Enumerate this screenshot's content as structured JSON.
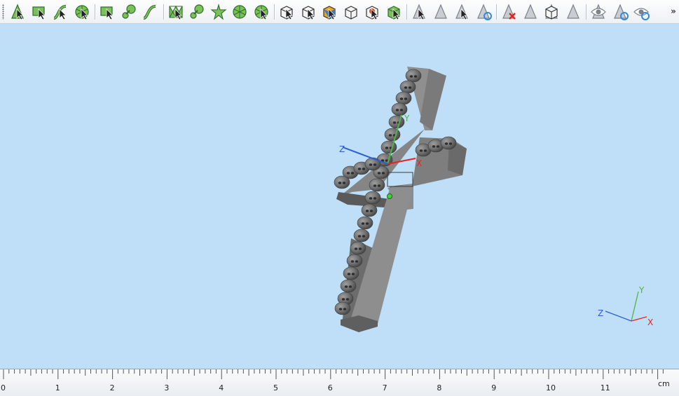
{
  "toolbar": {
    "groups": [
      [
        "select-face-icon",
        "select-surface-icon",
        "select-curve-surface-icon",
        "select-circle-face-icon"
      ],
      [
        "rectangle-select-icon",
        "blob-select-icon",
        "curve-select-icon"
      ],
      [
        "mesh-select-icon",
        "split-icon",
        "star-select-icon",
        "radial-select-icon",
        "radial-cut-icon"
      ],
      [
        "cube-select-icon",
        "cube-face-icon",
        "cube-orange-icon",
        "cube-wire-icon",
        "cube-red-icon",
        "cube-green-icon"
      ],
      [
        "triangle-icon",
        "triangle-edit-icon",
        "triangle-cursor-icon",
        "triangle-refresh-icon"
      ],
      [
        "triangle-delete-icon",
        "triangle-gray-icon",
        "triangle-copy-icon",
        "triangle-dim-icon"
      ],
      [
        "eye-hide-icon",
        "eye-refresh-icon",
        "eye-show-icon"
      ]
    ],
    "more_label": "»"
  },
  "viewport": {
    "background": "#bedff7",
    "model": "cross-with-skulls",
    "gizmo_labels": {
      "x": "X",
      "y": "Y",
      "z": "Z"
    },
    "triad_labels": {
      "x": "X",
      "y": "Y",
      "z": "Z"
    },
    "axis_colors": {
      "x": "#e8221e",
      "y": "#4fb34a",
      "z": "#2d5fd1"
    }
  },
  "ruler": {
    "unit": "cm",
    "labels": [
      "0",
      "1",
      "2",
      "3",
      "4",
      "5",
      "6",
      "7",
      "8",
      "9",
      "10",
      "11"
    ]
  }
}
